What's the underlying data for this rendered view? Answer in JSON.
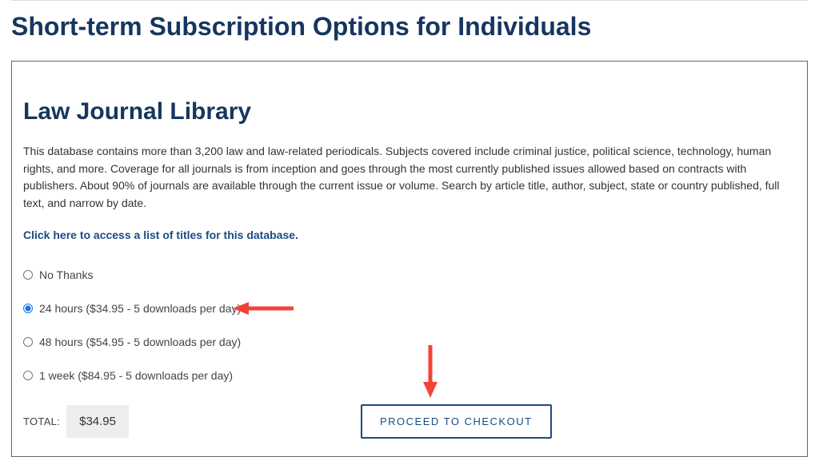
{
  "page": {
    "title": "Short-term Subscription Options for Individuals"
  },
  "card": {
    "title": "Law Journal Library",
    "description": "This database contains more than 3,200 law and law-related periodicals. Subjects covered include criminal justice, political science, technology, human rights, and more. Coverage for all journals is from inception and goes through the most currently published issues allowed based on contracts with publishers. About 90% of journals are available through the current issue or volume. Search by article title, author, subject, state or country published, full text, and narrow by date.",
    "link_text": "Click here to access a list of titles for this database."
  },
  "options": [
    {
      "label": "No Thanks",
      "selected": false
    },
    {
      "label": "24 hours ($34.95 - 5 downloads per day)",
      "selected": true
    },
    {
      "label": "48 hours ($54.95 - 5 downloads per day)",
      "selected": false
    },
    {
      "label": "1 week ($84.95 - 5 downloads per day)",
      "selected": false
    }
  ],
  "total": {
    "label": "TOTAL:",
    "value": "$34.95"
  },
  "checkout_label": "PROCEED TO CHECKOUT",
  "annotations": {
    "arrow_right_color": "#f44336",
    "arrow_down_color": "#f44336"
  }
}
